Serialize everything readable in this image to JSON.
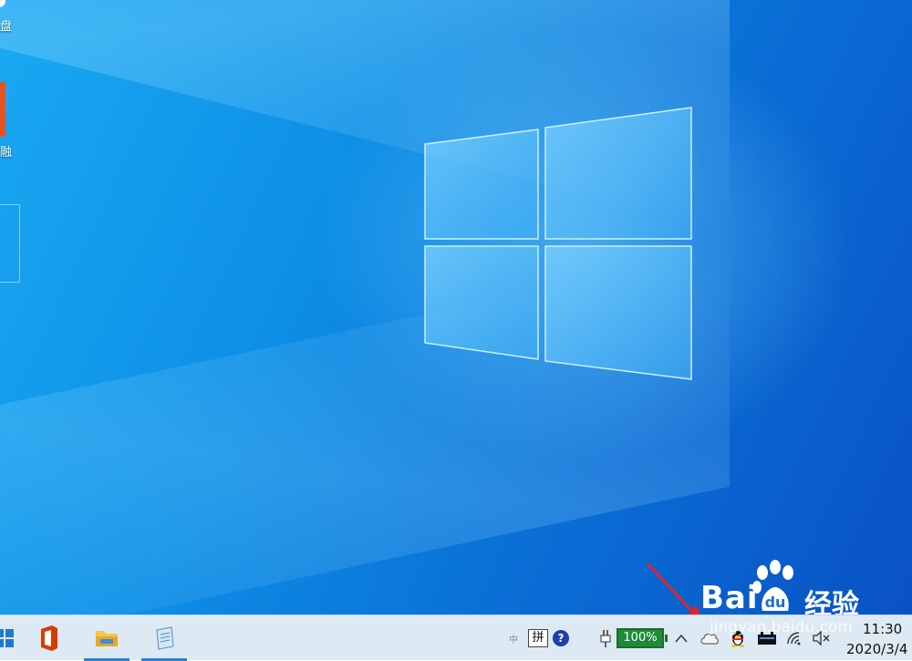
{
  "desktop": {
    "icons": [
      {
        "label": "盘",
        "icon": "drive-icon"
      },
      {
        "label": "融",
        "icon": "app-icon"
      },
      {
        "label": "",
        "icon": "selected-icon-frame"
      }
    ]
  },
  "watermark": {
    "logo_text": "Bai",
    "logo_suffix": "经验",
    "url": "jingyan.baidu.com"
  },
  "taskbar": {
    "apps": [
      {
        "name": "start",
        "icon": "windows-start-icon",
        "active": false
      },
      {
        "name": "office",
        "icon": "office-icon",
        "active": false
      },
      {
        "name": "file-explorer",
        "icon": "folder-icon",
        "active": true
      },
      {
        "name": "notepad",
        "icon": "notepad-icon",
        "active": true
      }
    ],
    "tray": {
      "ime_mode": "中",
      "ime_label": "拼",
      "help_label": "?",
      "battery_percent": "100%",
      "chevron": "^",
      "icons": [
        "cloud-icon",
        "qq-penguin-icon",
        "device-icon",
        "wifi-icon",
        "volume-muted-icon"
      ]
    },
    "clock": {
      "time": "11:30",
      "date": "2020/3/4"
    }
  },
  "colors": {
    "desktop_blue": "#0d8fe6",
    "taskbar_bg": "#dde9f3",
    "battery_green": "#1f8b3a",
    "arrow_red": "#e0242a"
  }
}
